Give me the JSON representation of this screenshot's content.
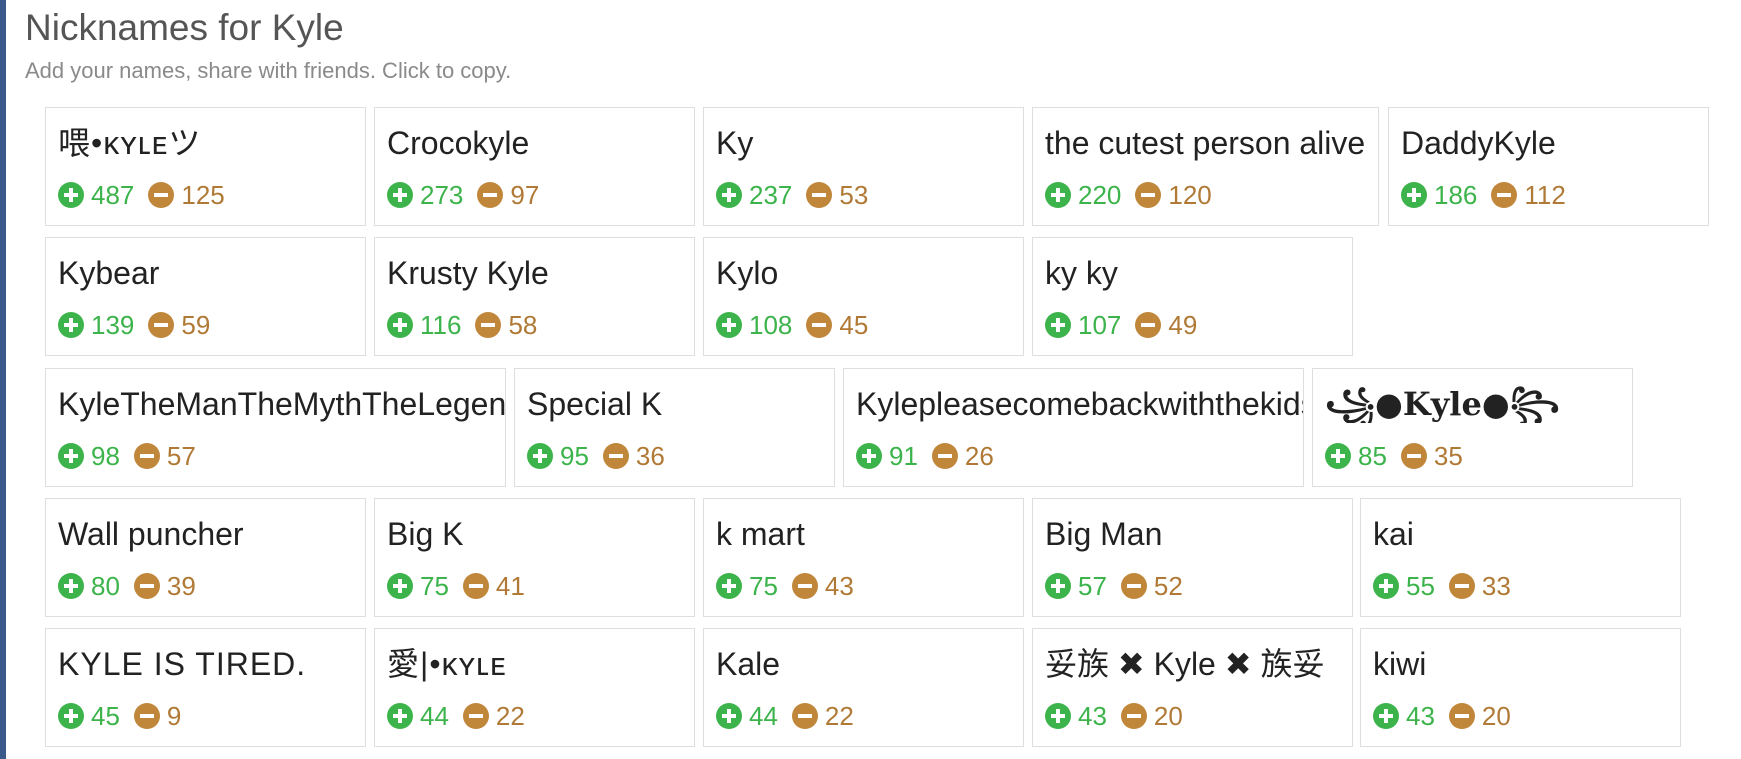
{
  "page": {
    "title": "Nicknames for Kyle",
    "subtitle": "Add your names, share with friends. Click to copy."
  },
  "colors": {
    "upvote": "#3cb44b",
    "downvote": "#c0863a",
    "rail": "#3a5a8c"
  },
  "icons": {
    "upvote": "plus-circle-icon",
    "downvote": "minus-circle-icon"
  },
  "nicknames": [
    {
      "name": "喂•ᴋʏʟᴇツ",
      "up": "487",
      "down": "125"
    },
    {
      "name": "Crocokyle",
      "up": "273",
      "down": "97"
    },
    {
      "name": "Ky",
      "up": "237",
      "down": "53"
    },
    {
      "name": "the cutest person alive",
      "up": "220",
      "down": "120"
    },
    {
      "name": "DaddyKyle",
      "up": "186",
      "down": "112"
    },
    {
      "name": "Kybear",
      "up": "139",
      "down": "59"
    },
    {
      "name": "Krusty Kyle",
      "up": "116",
      "down": "58"
    },
    {
      "name": "Kylo",
      "up": "108",
      "down": "45"
    },
    {
      "name": "ky ky",
      "up": "107",
      "down": "49"
    },
    {
      "name": "KyleTheManTheMythTheLegend",
      "up": "98",
      "down": "57"
    },
    {
      "name": "Special K",
      "up": "95",
      "down": "36"
    },
    {
      "name": "Kylepleasecomebackwiththekids",
      "up": "91",
      "down": "26"
    },
    {
      "name": "꧁●𝐊𝐲𝐥𝐞●꧂",
      "up": "85",
      "down": "35"
    },
    {
      "name": "Wall puncher",
      "up": "80",
      "down": "39"
    },
    {
      "name": "Big K",
      "up": "75",
      "down": "41"
    },
    {
      "name": "k mart",
      "up": "75",
      "down": "43"
    },
    {
      "name": "Big Man",
      "up": "57",
      "down": "52"
    },
    {
      "name": "kai",
      "up": "55",
      "down": "33"
    },
    {
      "name": "KYLE IS TIRED.",
      "up": "45",
      "down": "9"
    },
    {
      "name": "愛|•ᴋʏʟᴇ",
      "up": "44",
      "down": "22"
    },
    {
      "name": "Kale",
      "up": "44",
      "down": "22"
    },
    {
      "name": "妥族 ✖ Kyle ✖ 族妥",
      "up": "43",
      "down": "20"
    },
    {
      "name": "kiwi",
      "up": "43",
      "down": "20"
    }
  ]
}
